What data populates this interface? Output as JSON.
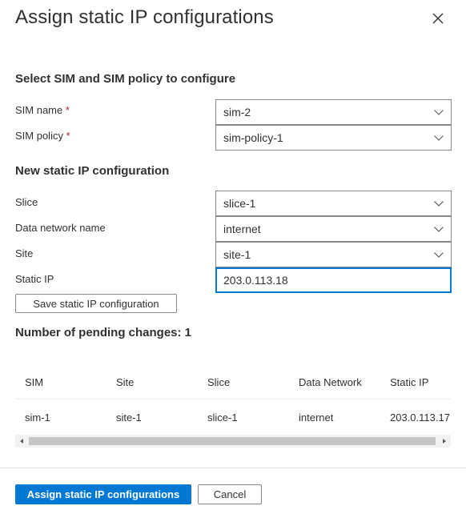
{
  "dialog": {
    "title": "Assign static IP configurations",
    "close_icon": "close-icon"
  },
  "select_section": {
    "heading": "Select SIM and SIM policy to configure",
    "sim_name": {
      "label": "SIM name",
      "required_mark": "*",
      "value": "sim-2"
    },
    "sim_policy": {
      "label": "SIM policy",
      "required_mark": "*",
      "value": "sim-policy-1"
    }
  },
  "new_config_section": {
    "heading": "New static IP configuration",
    "slice": {
      "label": "Slice",
      "value": "slice-1"
    },
    "data_network": {
      "label": "Data network name",
      "value": "internet"
    },
    "site": {
      "label": "Site",
      "value": "site-1"
    },
    "static_ip": {
      "label": "Static IP",
      "value": "203.0.113.18"
    },
    "save_button": "Save static IP configuration"
  },
  "pending": {
    "heading": "Number of pending changes: 1",
    "columns": [
      "SIM",
      "Site",
      "Slice",
      "Data Network",
      "Static IP"
    ],
    "rows": [
      [
        "sim-1",
        "site-1",
        "slice-1",
        "internet",
        "203.0.113.17"
      ]
    ]
  },
  "footer": {
    "primary_button": "Assign static IP configurations",
    "cancel_button": "Cancel"
  },
  "colors": {
    "accent": "#0078d4",
    "required": "#a4262c",
    "border": "#8a8886"
  }
}
